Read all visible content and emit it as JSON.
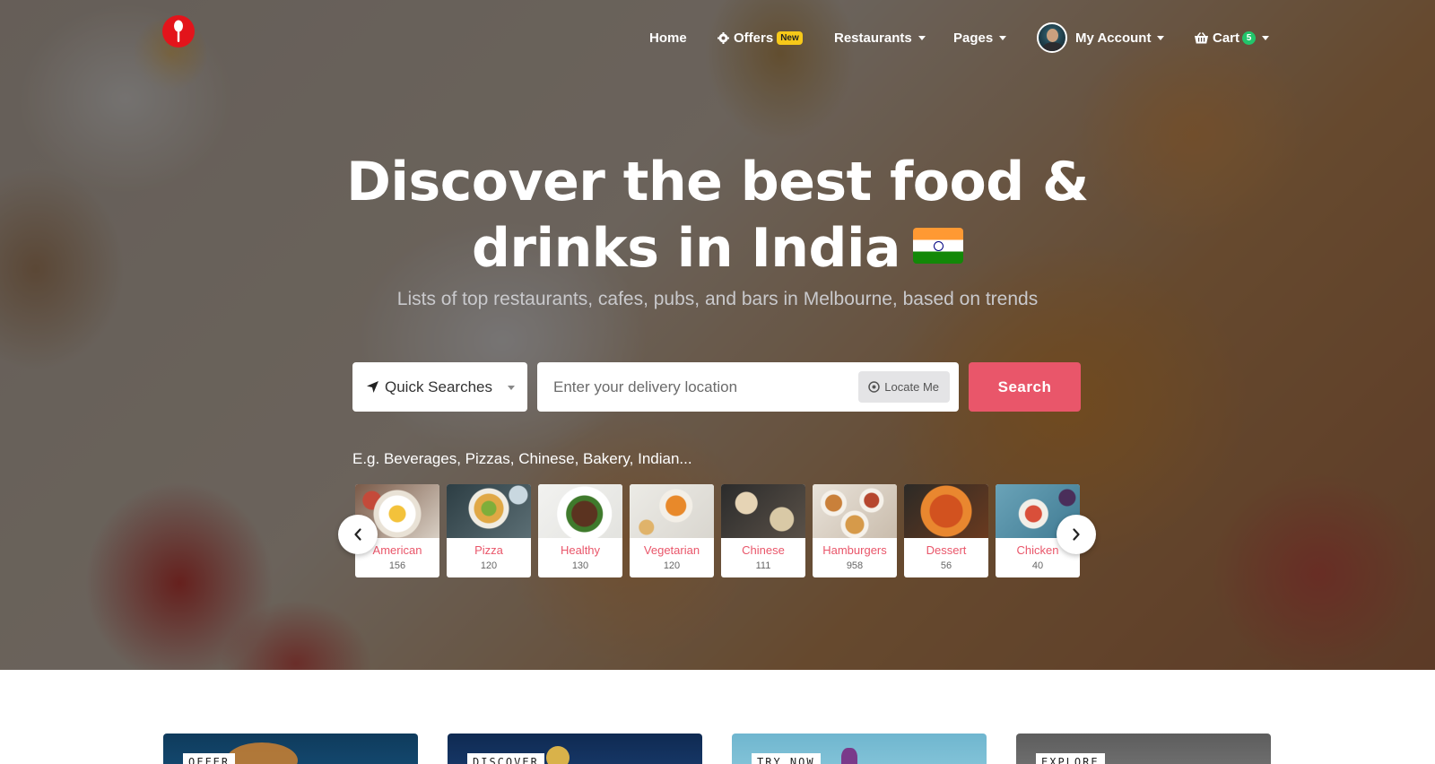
{
  "nav": {
    "home": "Home",
    "offers": "Offers",
    "offers_badge": "New",
    "restaurants": "Restaurants",
    "pages": "Pages",
    "account": "My Account",
    "cart": "Cart",
    "cart_count": "5"
  },
  "hero": {
    "title_line1": "Discover the best food &",
    "title_line2": "drinks in India",
    "subtitle": "Lists of top restaurants, cafes, pubs, and bars in Melbourne, based on trends"
  },
  "search": {
    "quick_label": "Quick Searches",
    "location_placeholder": "Enter your delivery location",
    "locate_label": "Locate Me",
    "button_label": "Search",
    "examples": "E.g. Beverages, Pizzas, Chinese, Bakery, Indian..."
  },
  "categories": [
    {
      "name": "American",
      "count": "156"
    },
    {
      "name": "Pizza",
      "count": "120"
    },
    {
      "name": "Healthy",
      "count": "130"
    },
    {
      "name": "Vegetarian",
      "count": "120"
    },
    {
      "name": "Chinese",
      "count": "111"
    },
    {
      "name": "Hamburgers",
      "count": "958"
    },
    {
      "name": "Dessert",
      "count": "56"
    },
    {
      "name": "Chicken",
      "count": "40"
    }
  ],
  "promos": [
    {
      "tag": "OFFER"
    },
    {
      "tag": "DISCOVER"
    },
    {
      "tag": "TRY NOW"
    },
    {
      "tag": "EXPLORE"
    }
  ],
  "icons": {
    "logo": "spoon-icon",
    "offers": "gear-badge-icon",
    "cart": "basket-icon",
    "quick": "location-arrow-icon",
    "locate": "crosshair-icon",
    "prev": "chevron-left-icon",
    "next": "chevron-right-icon"
  },
  "colors": {
    "accent": "#e9566a",
    "logo": "#e3141b",
    "new_badge": "#f7c919",
    "cart_badge": "#22c56b"
  }
}
